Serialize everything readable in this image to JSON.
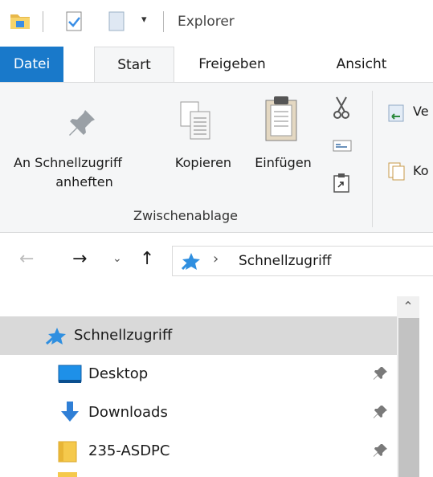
{
  "window": {
    "title": "Explorer"
  },
  "tabs": [
    {
      "label": "Datei"
    },
    {
      "label": "Start"
    },
    {
      "label": "Freigeben"
    },
    {
      "label": "Ansicht"
    }
  ],
  "ribbon": {
    "pin_label_line1": "An Schnellzugriff",
    "pin_label_line2": "anheften",
    "copy_label": "Kopieren",
    "paste_label": "Einfügen",
    "group_label": "Zwischenablage",
    "cut_partial": "Ve",
    "copyto_partial": "Ko"
  },
  "address": {
    "path": "Schnellzugriff"
  },
  "navpane": {
    "items": [
      {
        "label": "Schnellzugriff",
        "selected": true
      },
      {
        "label": "Desktop"
      },
      {
        "label": "Downloads"
      },
      {
        "label": "235-ASDPC"
      }
    ]
  },
  "colors": {
    "accent": "#1979ca",
    "selected_row": "#d9d9d9"
  }
}
